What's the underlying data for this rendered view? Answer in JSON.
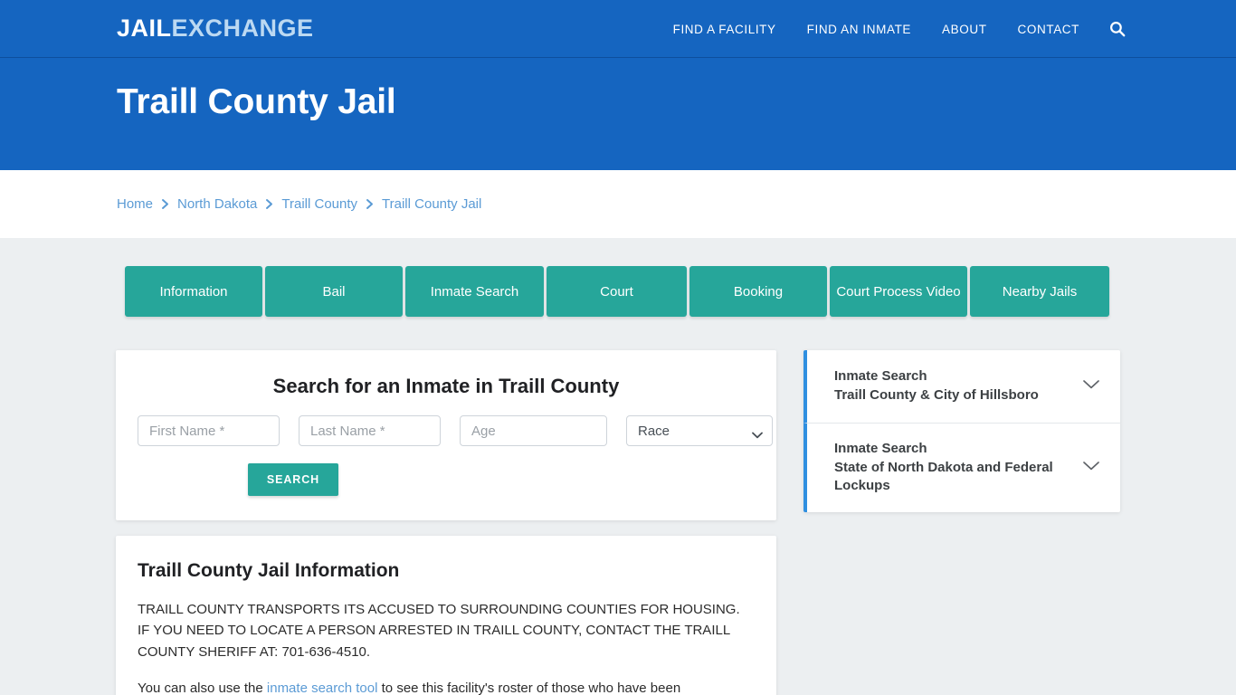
{
  "header": {
    "logo_primary": "JAIL",
    "logo_secondary": "EXCHANGE",
    "nav": [
      {
        "label": "FIND A FACILITY"
      },
      {
        "label": "FIND AN INMATE"
      },
      {
        "label": "ABOUT"
      },
      {
        "label": "CONTACT"
      }
    ],
    "search_icon": "search-icon",
    "bg_color": "#1565c0"
  },
  "hero": {
    "title": "Traill County Jail"
  },
  "breadcrumb": {
    "separator": "›",
    "items": [
      {
        "label": "Home"
      },
      {
        "label": "North Dakota"
      },
      {
        "label": "Traill County"
      },
      {
        "label": "Traill County Jail"
      }
    ]
  },
  "tabs": [
    {
      "label": "Information"
    },
    {
      "label": "Bail"
    },
    {
      "label": "Inmate Search"
    },
    {
      "label": "Court"
    },
    {
      "label": "Booking"
    },
    {
      "label": "Court Process Video"
    },
    {
      "label": "Nearby Jails"
    }
  ],
  "search_panel": {
    "heading": "Search for an Inmate in Traill County",
    "first_name_placeholder": "First Name *",
    "last_name_placeholder": "Last Name *",
    "age_placeholder": "Age",
    "race_selected": "Race",
    "race_options": [
      "Race"
    ],
    "search_button": "SEARCH",
    "accent_color": "#26a69a"
  },
  "info_panel": {
    "heading": "Traill County Jail Information",
    "paragraph_1": "TRAILL COUNTY TRANSPORTS ITS ACCUSED TO SURROUNDING COUNTIES FOR HOUSING.  IF YOU NEED TO LOCATE A PERSON ARRESTED IN TRAILL COUNTY, CONTACT THE TRAILL COUNTY SHERIFF AT: 701-636-4510.",
    "paragraph_2_before": "You can also use the ",
    "paragraph_2_link": "inmate search tool",
    "paragraph_2_after": " to see this facility's roster of those who have been"
  },
  "rail": {
    "accent_color": "#2f8fe0",
    "panels": [
      {
        "line1": "Inmate Search",
        "line2": "Traill County & City of Hillsboro",
        "chevron": "chevron-down-icon"
      },
      {
        "line1": "Inmate Search",
        "line2": "State of North Dakota and Federal Lockups",
        "chevron": "chevron-down-icon"
      }
    ]
  }
}
